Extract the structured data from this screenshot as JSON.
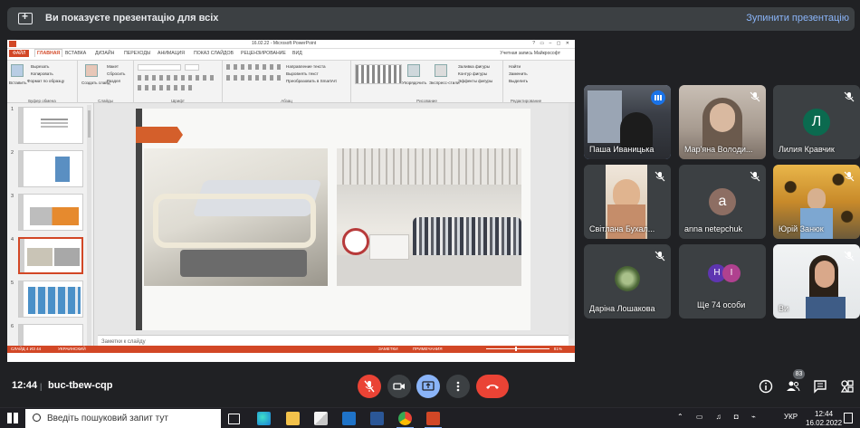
{
  "banner": {
    "title": "Ви показуєте презентацію для всіх",
    "stop_label": "Зупинити презентацію"
  },
  "powerpoint": {
    "window_title": "16.02.22 - Microsoft PowerPoint",
    "tabs": [
      "ФАЙЛ",
      "ГЛАВНАЯ",
      "ВСТАВКА",
      "ДИЗАЙН",
      "ПЕРЕХОДЫ",
      "АНИМАЦИЯ",
      "ПОКАЗ СЛАЙДОВ",
      "РЕЦЕНЗИРОВАНИЕ",
      "ВИД"
    ],
    "account": "Учетная запись Майкрософт",
    "ribbon": {
      "insert": "Вставить",
      "cut": "Вырезать",
      "copy": "Копировать",
      "format_painter": "Формат по образцу",
      "clipboard": "Буфер обмена",
      "create_slide": "Создать слайд",
      "layout": "Макет",
      "reset": "Сбросить",
      "section": "Раздел",
      "slides_group": "Слайды",
      "font_group": "Шрифт",
      "text_direction": "Направление текста",
      "align_text": "Выровнять текст",
      "smartart": "Преобразовать в SmartArt",
      "paragraph_group": "Абзац",
      "arrange": "Упорядочить",
      "quick_styles": "Экспресс-стили",
      "shape_fill": "Заливка фигуры",
      "shape_outline": "Контур фигуры",
      "shape_effects": "Эффекты фигуры",
      "drawing_group": "Рисование",
      "find": "Найти",
      "replace": "Заменить",
      "select": "Выделить",
      "editing_group": "Редактирование"
    },
    "slide_numbers": [
      "1",
      "2",
      "3",
      "4",
      "5",
      "6"
    ],
    "notes_placeholder": "Заметки к слайду",
    "status": {
      "slide": "СЛАЙД 4 ИЗ 44",
      "lang": "УКРАИНСКИЙ",
      "notes": "ЗАМЕТКИ",
      "comments": "ПРИМЕЧАНИЯ",
      "zoom": "81%"
    }
  },
  "participants": [
    {
      "name": "Паша Иваницька",
      "muted": false,
      "speaking": true
    },
    {
      "name": "Мар'яна Володи...",
      "muted": true
    },
    {
      "name": "Лилия Кравчик",
      "muted": true,
      "initial": "Л",
      "avatar_color": "#0b6a4f"
    },
    {
      "name": "Світлана Бухал...",
      "muted": true
    },
    {
      "name": "anna netepchuk",
      "muted": true,
      "initial": "a",
      "avatar_color": "#8d6e63"
    },
    {
      "name": "Юрій Занюк",
      "muted": true
    },
    {
      "name": "Даріна Лошакова",
      "muted": true
    },
    {
      "name": "Ще 74 особи",
      "muted": false,
      "initials": [
        "Н",
        "І"
      ],
      "colors": [
        "#5e35b1",
        "#b0418f"
      ]
    },
    {
      "name": "Ви",
      "muted": true
    }
  ],
  "bottom_bar": {
    "time": "12:44",
    "divider": "|",
    "meeting_code": "buc-tbew-cqp",
    "people_count": "83"
  },
  "taskbar": {
    "search_placeholder": "Введіть пошуковий запит тут",
    "lang": "УКР",
    "time": "12:44",
    "date": "16.02.2022"
  }
}
